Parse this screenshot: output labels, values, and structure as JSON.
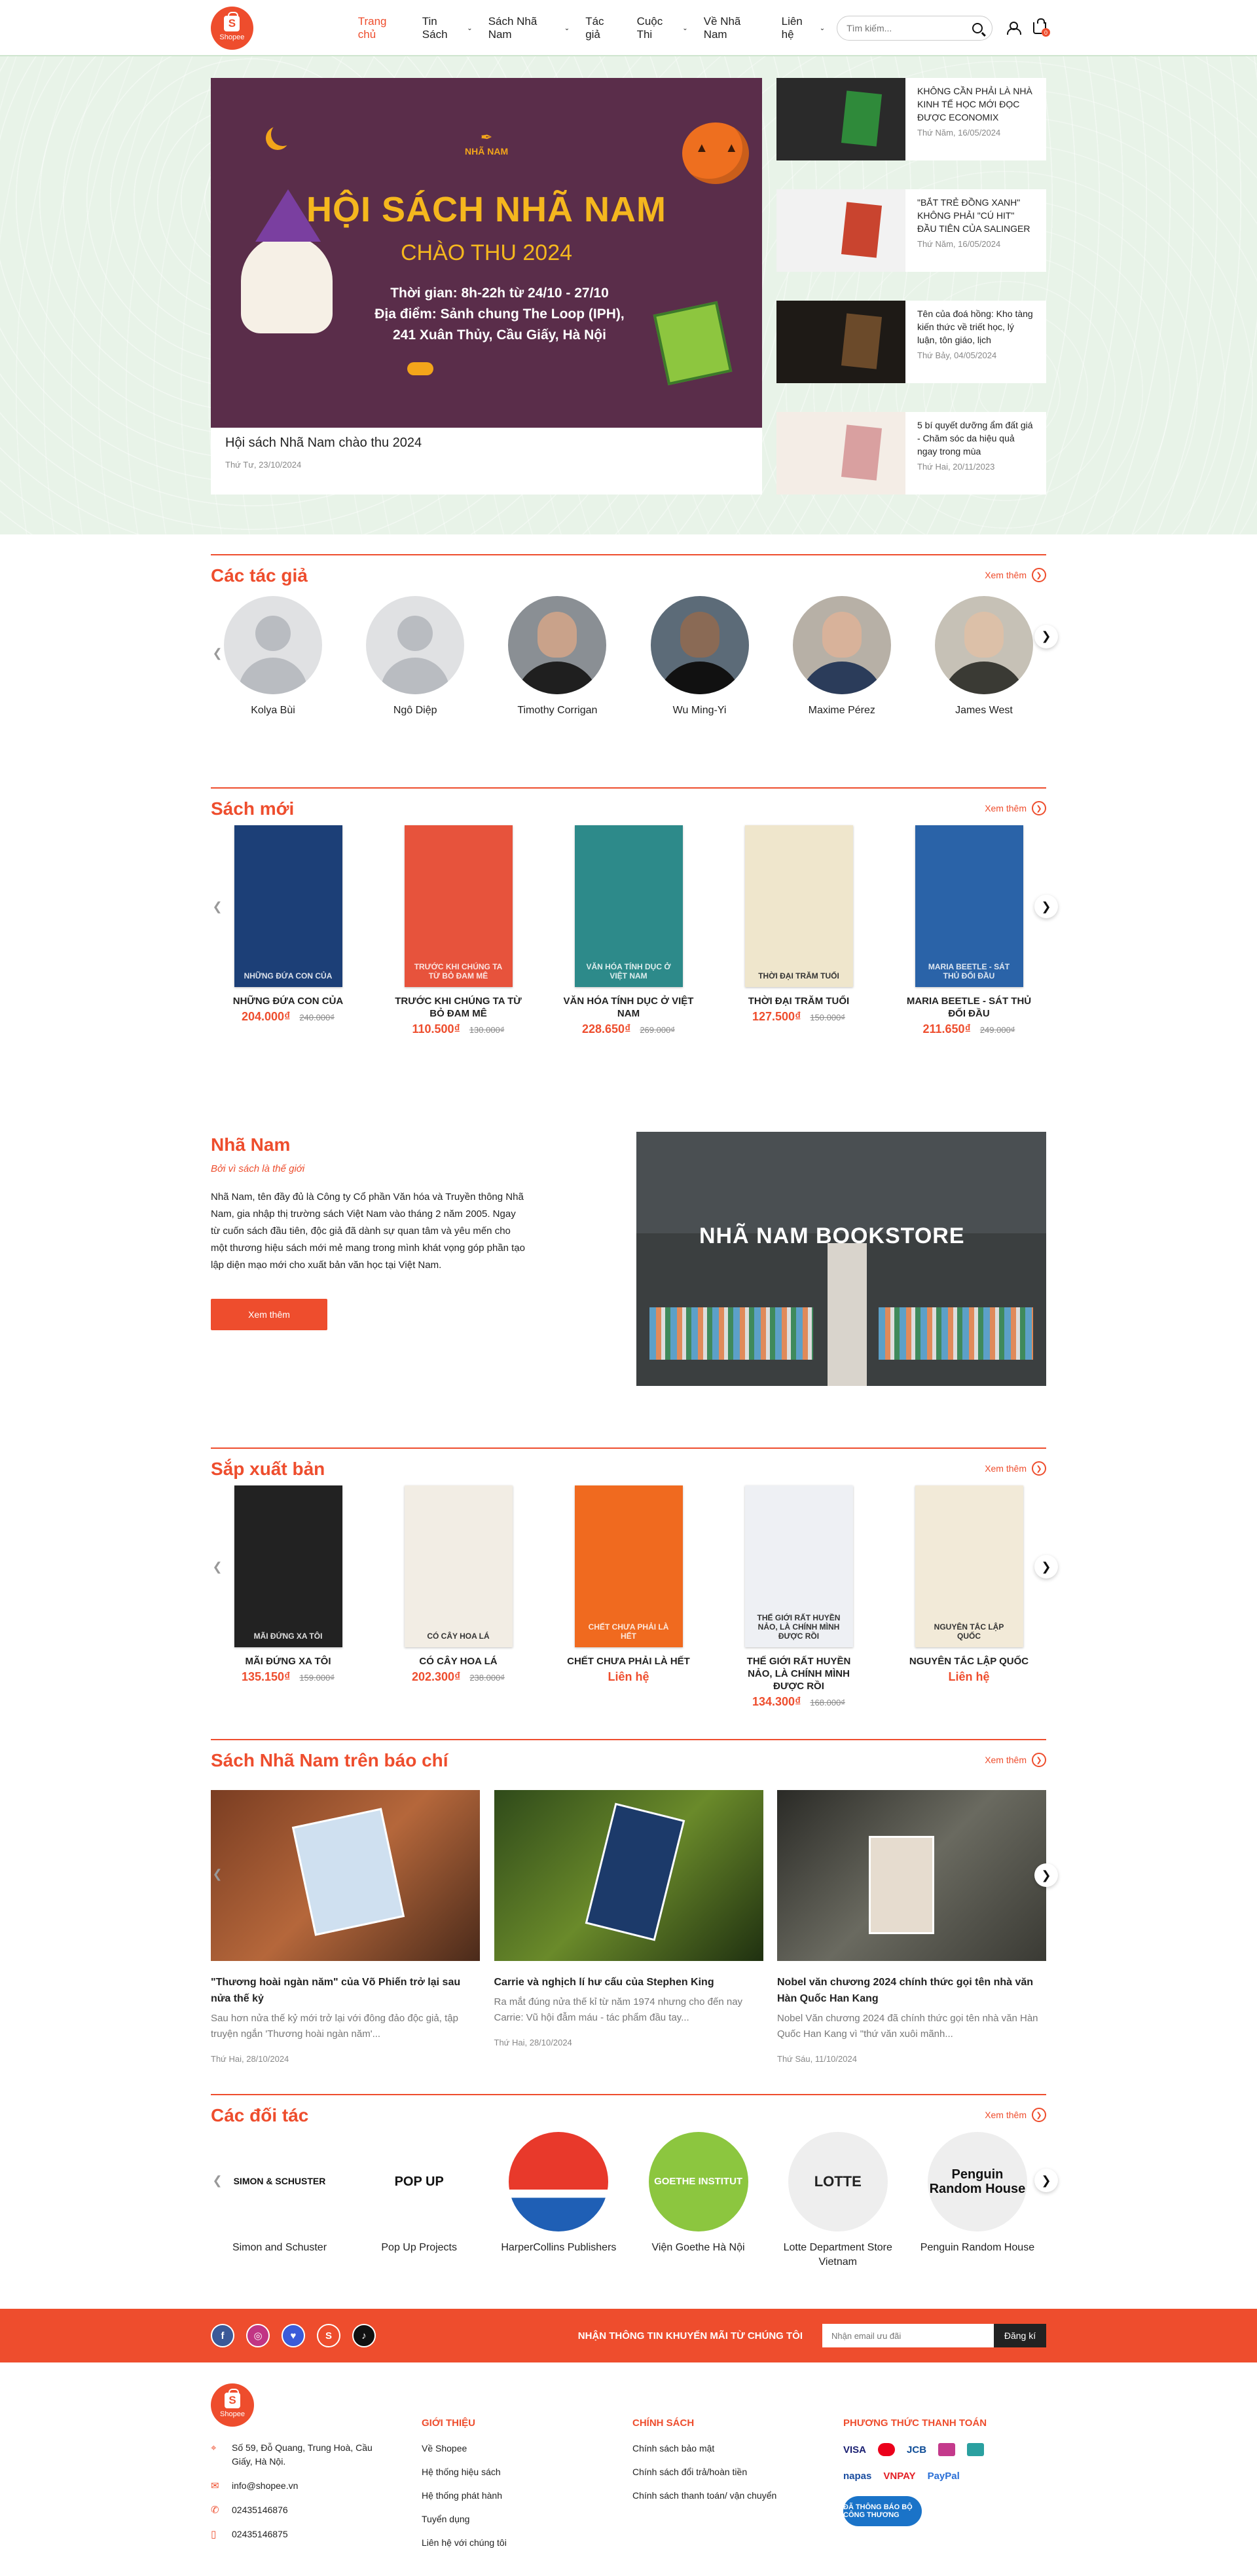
{
  "header": {
    "logo_text": "Shopee",
    "nav": [
      {
        "label": "Trang chủ",
        "active": true,
        "dropdown": false
      },
      {
        "label": "Tin Sách",
        "active": false,
        "dropdown": true
      },
      {
        "label": "Sách Nhã Nam",
        "active": false,
        "dropdown": true
      },
      {
        "label": "Tác giả",
        "active": false,
        "dropdown": false
      },
      {
        "label": "Cuộc Thi",
        "active": false,
        "dropdown": true
      },
      {
        "label": "Về Nhã Nam",
        "active": false,
        "dropdown": false
      },
      {
        "label": "Liên hệ",
        "active": false,
        "dropdown": true
      }
    ],
    "search_placeholder": "Tìm kiếm...",
    "cart_count": "0",
    "icons": [
      "search-icon",
      "user-icon",
      "cart-icon"
    ]
  },
  "hero": {
    "banner": {
      "publisher": "NHÃ NAM",
      "title": "HỘI SÁCH NHÃ NAM",
      "subtitle": "CHÀO THU 2024",
      "line1": "Thời gian: 8h-22h từ 24/10 - 27/10",
      "line2": "Địa điểm: Sảnh chung The Loop (IPH),",
      "line3": "241 Xuân Thủy, Cầu Giấy, Hà Nội"
    },
    "main_title": "Hội sách Nhã Nam chào thu 2024",
    "main_date": "Thứ Tư, 23/10/2024",
    "side": [
      {
        "title": "KHÔNG CẦN PHẢI LÀ NHÀ KINH TẾ HỌC MỚI ĐỌC ĐƯỢC ECONOMIX",
        "date": "Thứ Năm, 16/05/2024"
      },
      {
        "title": "\"BẮT TRẺ ĐỒNG XANH\" KHÔNG PHẢI \"CÚ HIT\" ĐẦU TIÊN CỦA SALINGER",
        "date": "Thứ Năm, 16/05/2024"
      },
      {
        "title": "Tên của đoá hồng: Kho tàng kiến thức về triết học, lý luận, tôn giáo, lịch",
        "date": "Thứ Bảy, 04/05/2024"
      },
      {
        "title": "5 bí quyết dưỡng ẩm đất giá - Chăm sóc da hiệu quả ngay trong mùa",
        "date": "Thứ Hai, 20/11/2023"
      }
    ]
  },
  "more_label": "Xem thêm",
  "authors": {
    "title": "Các tác giả",
    "items": [
      {
        "name": "Kolya Bùi"
      },
      {
        "name": "Ngô Diệp"
      },
      {
        "name": "Timothy Corrigan"
      },
      {
        "name": "Wu Ming-Yi"
      },
      {
        "name": "Maxime Pérez"
      },
      {
        "name": "James West"
      }
    ]
  },
  "new_books": {
    "title": "Sách mới",
    "items": [
      {
        "title": "NHỮNG ĐỨA CON CỦA",
        "price": "204.000₫",
        "old": "240.000₫",
        "color": "#1c3f77"
      },
      {
        "title": "TRƯỚC KHI CHÚNG TA TỪ BỎ ĐAM MÊ",
        "price": "110.500₫",
        "old": "130.000₫",
        "color": "#e7533c"
      },
      {
        "title": "VĂN HÓA TÍNH DỤC Ở VIỆT NAM",
        "price": "228.650₫",
        "old": "269.000₫",
        "color": "#2d8a8a"
      },
      {
        "title": "THỜI ĐẠI TRĂM TUỔI",
        "price": "127.500₫",
        "old": "150.000₫",
        "color": "#efe6cc"
      },
      {
        "title": "MARIA BEETLE - SÁT THỦ ĐỐI ĐẦU",
        "price": "211.650₫",
        "old": "249.000₫",
        "color": "#2a63a8"
      }
    ]
  },
  "about": {
    "title": "Nhã Nam",
    "tagline": "Bởi vì sách là thế giới",
    "body": "Nhã Nam, tên đầy đủ là Công ty Cổ phần Văn hóa và Truyền thông Nhã Nam, gia nhập thị trường sách Việt Nam vào tháng 2 năm 2005. Ngay từ cuốn sách đầu tiên, độc giả đã dành sự quan tâm và yêu mến cho một thương hiệu sách mới mẻ mang trong mình khát vọng góp phần tạo lập diện mạo mới cho xuất bản văn học tại Việt Nam.",
    "button": "Xem thêm",
    "store_sign": "NHÃ NAM BOOKSTORE"
  },
  "upcoming": {
    "title": "Sắp xuất bản",
    "items": [
      {
        "title": "MÃI ĐỨNG XA TÔI",
        "price": "135.150₫",
        "old": "159.000₫",
        "contact": "",
        "color": "#222"
      },
      {
        "title": "CÓ CÂY HOA LÁ",
        "price": "202.300₫",
        "old": "238.000₫",
        "contact": "",
        "color": "#f2ede4"
      },
      {
        "title": "CHẾT CHƯA PHẢI LÀ HẾT",
        "price": "",
        "old": "",
        "contact": "Liên hệ",
        "color": "#f06a1f"
      },
      {
        "title": "THẾ GIỚI RẤT HUYỀN NẢO, LÀ CHÍNH MÌNH ĐƯỢC RỒI",
        "price": "134.300₫",
        "old": "168.000₫",
        "contact": "",
        "color": "#eef0f4"
      },
      {
        "title": "NGUYÊN TẮC LẬP QUỐC",
        "price": "",
        "old": "",
        "contact": "Liên hệ",
        "color": "#f2ead8"
      }
    ]
  },
  "press": {
    "title": "Sách Nhã Nam trên báo chí",
    "items": [
      {
        "title": "\"Thương hoài ngàn năm\" của Võ Phiến trở lại sau nửa thế kỷ",
        "desc": "Sau hơn nửa thế kỷ mới trở lại với đông đảo độc giả, tập truyện ngắn 'Thương hoài ngàn năm'...",
        "date": "Thứ Hai, 28/10/2024"
      },
      {
        "title": "Carrie và nghịch lí hư cấu của Stephen King",
        "desc": "Ra mắt đúng nửa thế kỉ từ năm 1974 nhưng cho đến nay Carrie: Vũ hội đẫm máu - tác phẩm đầu tay...",
        "date": "Thứ Hai, 28/10/2024"
      },
      {
        "title": "Nobel văn chương 2024 chính thức gọi tên nhà văn Hàn Quốc Han Kang",
        "desc": "Nobel Văn chương 2024 đã chính thức gọi tên nhà văn Hàn Quốc Han Kang vì \"thứ văn xuôi mãnh...",
        "date": "Thứ Sáu, 11/10/2024"
      }
    ]
  },
  "partners": {
    "title": "Các đối tác",
    "items": [
      {
        "name": "Simon and Schuster",
        "logo": "SIMON & SCHUSTER"
      },
      {
        "name": "Pop Up Projects",
        "logo": "POP UP"
      },
      {
        "name": "HarperCollins Publishers",
        "logo": ""
      },
      {
        "name": "Viện Goethe Hà Nội",
        "logo": "GOETHE INSTITUT"
      },
      {
        "name": "Lotte Department Store Vietnam",
        "logo": "LOTTE"
      },
      {
        "name": "Penguin Random House",
        "logo": "Penguin Random House"
      }
    ]
  },
  "newsletter": {
    "label": "NHẬN THÔNG TIN KHUYẾN MÃI TỪ CHÚNG TÔI",
    "placeholder": "Nhận email ưu đãi",
    "button": "Đăng kí",
    "socials": [
      "facebook-icon",
      "instagram-icon",
      "messenger-icon",
      "shopee-icon",
      "tiktok-icon"
    ]
  },
  "footer": {
    "logo_text": "Shopee",
    "address": "Số 59, Đỗ Quang, Trung Hoà, Cầu Giấy, Hà Nội.",
    "email": "info@shopee.vn",
    "phone1": "02435146876",
    "phone2": "02435146875",
    "about_title": "GIỚI THIỆU",
    "about_links": [
      "Về Shopee",
      "Hệ thống hiệu sách",
      "Hệ thống phát hành",
      "Tuyển dụng",
      "Liên hệ với chúng tôi"
    ],
    "policy_title": "CHÍNH SÁCH",
    "policy_links": [
      "Chính sách bảo mật",
      "Chính sách đổi trả/hoàn tiền",
      "Chính sách thanh toán/ vận chuyển"
    ],
    "payment_title": "PHƯƠNG THỨC THANH TOÁN",
    "payment_row1": [
      "VISA",
      "mastercard",
      "JCB",
      "amex",
      "cash"
    ],
    "payment_row2": [
      "napas",
      "VNPAY",
      "PayPal"
    ],
    "bct": "ĐÃ THÔNG BÁO BỘ CÔNG THƯƠNG"
  }
}
